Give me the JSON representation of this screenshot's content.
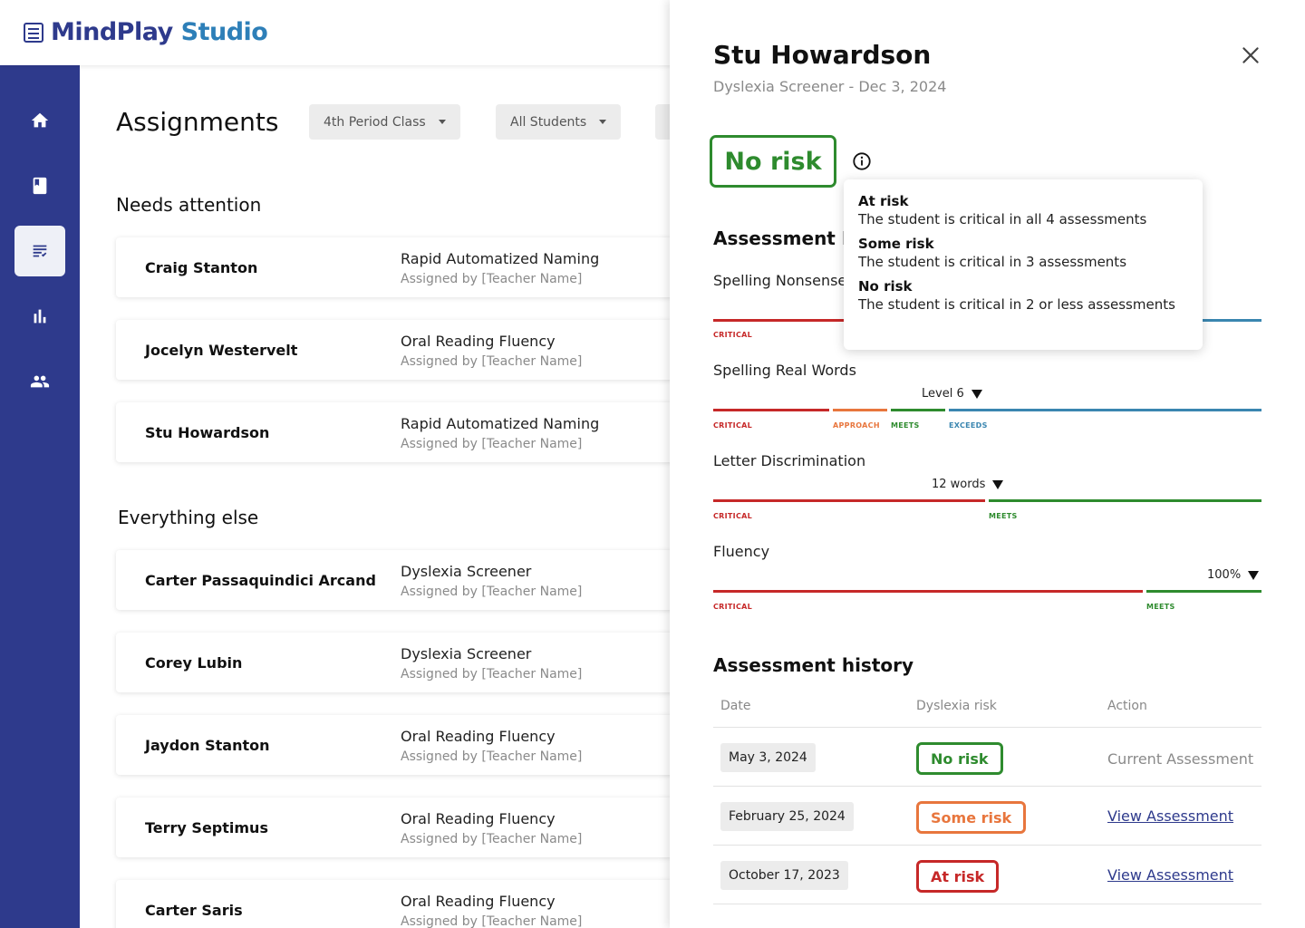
{
  "app": {
    "logo_main": "MindPlay",
    "logo_accent": "Studio",
    "brand_color": "#2e3a8c"
  },
  "sidebar": {
    "items": [
      {
        "name": "home",
        "icon": "home-icon",
        "active": false
      },
      {
        "name": "book",
        "icon": "book-icon",
        "active": false
      },
      {
        "name": "assignments",
        "icon": "assignment-icon",
        "active": true
      },
      {
        "name": "reports",
        "icon": "bar-chart-icon",
        "active": false
      },
      {
        "name": "students",
        "icon": "people-icon",
        "active": false
      }
    ]
  },
  "main": {
    "title": "Assignments",
    "filters": [
      {
        "label": "4th Period Class"
      },
      {
        "label": "All Students"
      }
    ],
    "sections": [
      {
        "title": "Needs attention",
        "cards": [
          {
            "name": "Craig Stanton",
            "assignment": "Rapid Automatized Naming",
            "assigned_by": "Assigned by [Teacher Name]"
          },
          {
            "name": "Jocelyn Westervelt",
            "assignment": "Oral Reading Fluency",
            "assigned_by": "Assigned by [Teacher Name]"
          },
          {
            "name": "Stu Howardson",
            "assignment": "Rapid Automatized Naming",
            "assigned_by": "Assigned by [Teacher Name]"
          }
        ]
      },
      {
        "title": "Everything else",
        "cards": [
          {
            "name": "Carter Passaquindici Arcand",
            "assignment": "Dyslexia Screener",
            "assigned_by": "Assigned by [Teacher Name]"
          },
          {
            "name": "Corey Lubin",
            "assignment": "Dyslexia Screener",
            "assigned_by": "Assigned by [Teacher Name]"
          },
          {
            "name": "Jaydon Stanton",
            "assignment": "Oral Reading Fluency",
            "assigned_by": "Assigned by [Teacher Name]"
          },
          {
            "name": "Terry Septimus",
            "assignment": "Oral Reading Fluency",
            "assigned_by": "Assigned by [Teacher Name]"
          },
          {
            "name": "Carter Saris",
            "assignment": "Oral Reading Fluency",
            "assigned_by": "Assigned by [Teacher Name]"
          }
        ]
      }
    ]
  },
  "drawer": {
    "student_name": "Stu Howardson",
    "subtitle": "Dyslexia Screener - Dec 3, 2024",
    "close_icon": "close-icon",
    "risk_label": "No risk",
    "risk_color": "#2e8b2e",
    "info_icon": "info-icon",
    "results_heading": "Assessment R",
    "measures": [
      {
        "label": "Spelling Nonsense",
        "marker": "",
        "segments": [
          "CRITICAL"
        ]
      },
      {
        "label": "Spelling Real Words",
        "marker": "Level 6",
        "segments": [
          "CRITICAL",
          "APPROACH",
          "MEETS",
          "EXCEEDS"
        ]
      },
      {
        "label": "Letter Discrimination",
        "marker": "12 words",
        "segments": [
          "CRITICAL",
          "MEETS"
        ]
      },
      {
        "label": "Fluency",
        "marker": "100%",
        "segments": [
          "CRITICAL",
          "MEETS"
        ]
      }
    ],
    "history": {
      "heading": "Assessment history",
      "columns": [
        "Date",
        "Dyslexia risk",
        "Action"
      ],
      "rows": [
        {
          "date": "May 3, 2024",
          "risk": "No risk",
          "risk_color": "#2e8b2e",
          "action": "Current Assessment"
        },
        {
          "date": "February 25, 2024",
          "risk": "Some risk",
          "risk_color": "#e8763d",
          "action": "View Assessment"
        },
        {
          "date": "October 17, 2023",
          "risk": "At risk",
          "risk_color": "#c62828",
          "action": "View Assessment"
        }
      ]
    }
  },
  "tooltip": {
    "items": [
      {
        "title": "At risk",
        "desc": "The student is critical in all 4 assessments"
      },
      {
        "title": "Some risk",
        "desc": "The student is critical in 3 assessments"
      },
      {
        "title": "No risk",
        "desc": "The student is critical in 2 or less assessments"
      }
    ]
  },
  "colors": {
    "critical": "#c62828",
    "approach": "#e8763d",
    "meets": "#2e8b2e",
    "exceeds": "#3a86b0"
  }
}
